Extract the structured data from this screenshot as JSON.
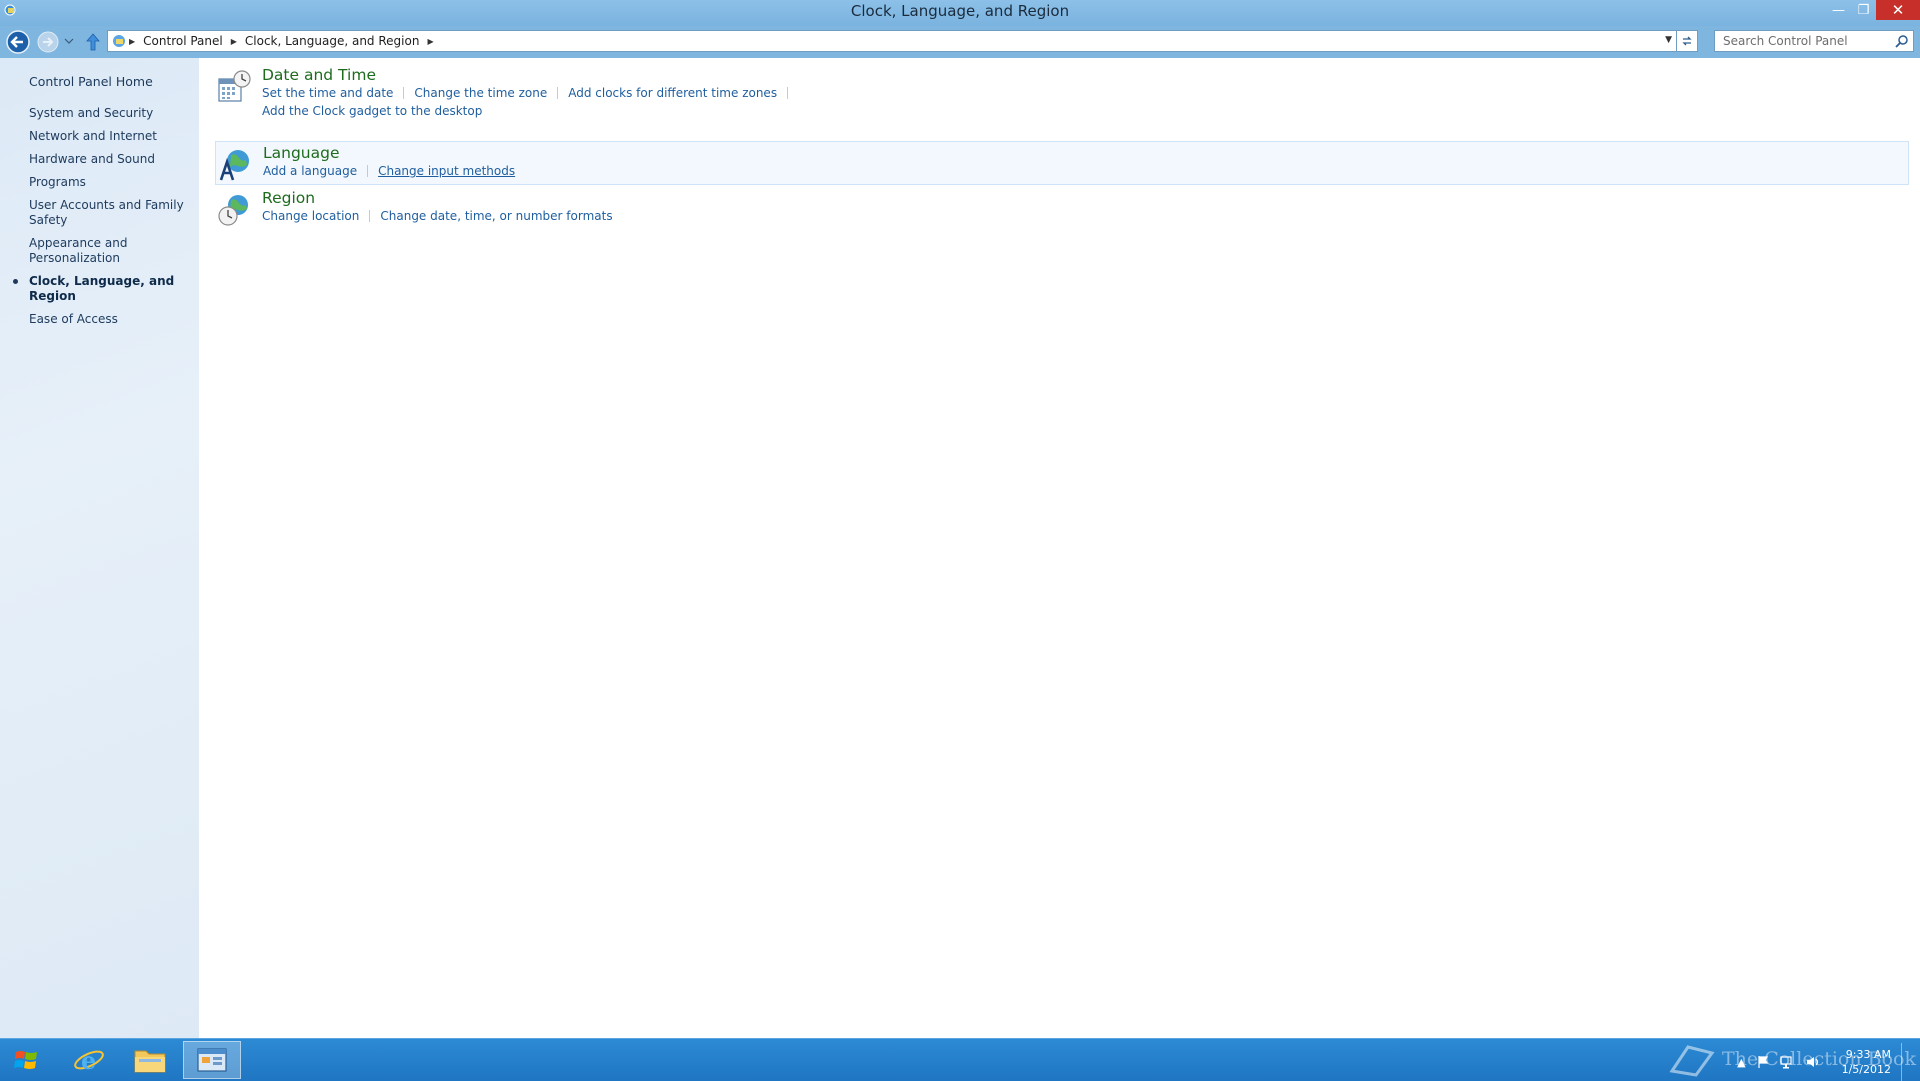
{
  "window": {
    "title": "Clock, Language, and Region"
  },
  "address": {
    "crumbs": [
      "Control Panel",
      "Clock, Language, and Region"
    ]
  },
  "search": {
    "placeholder": "Search Control Panel"
  },
  "sidebar": {
    "home": "Control Panel Home",
    "items": [
      {
        "label": "System and Security"
      },
      {
        "label": "Network and Internet"
      },
      {
        "label": "Hardware and Sound"
      },
      {
        "label": "Programs"
      },
      {
        "label": "User Accounts and Family Safety"
      },
      {
        "label": "Appearance and Personalization"
      },
      {
        "label": "Clock, Language, and Region",
        "active": true
      },
      {
        "label": "Ease of Access"
      }
    ]
  },
  "categories": [
    {
      "title": "Date and Time",
      "icon": "calendar-clock-icon",
      "links": [
        "Set the time and date",
        "Change the time zone",
        "Add clocks for different time zones"
      ],
      "links2": [
        "Add the Clock gadget to the desktop"
      ]
    },
    {
      "title": "Language",
      "icon": "language-globe-icon",
      "links": [
        "Add a language",
        "Change input methods"
      ]
    },
    {
      "title": "Region",
      "icon": "region-globe-clock-icon",
      "links": [
        "Change location",
        "Change date, time, or number formats"
      ]
    }
  ],
  "taskbar": {
    "clock_time": "9:33 AM",
    "clock_date": "1/5/2012",
    "watermark": "The Collection Book"
  },
  "colors": {
    "accent": "#1f76c2",
    "category_title": "#1e6b1e",
    "link": "#1f5e9e"
  }
}
